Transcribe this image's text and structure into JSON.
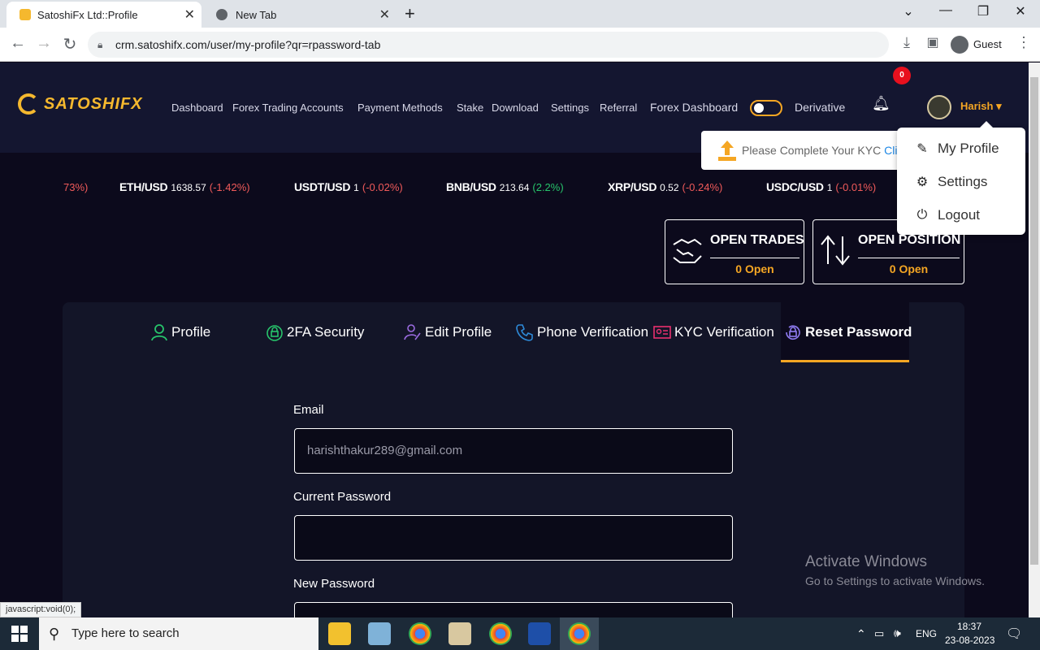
{
  "browser": {
    "tabs": [
      {
        "title": "SatoshiFx Ltd::Profile"
      },
      {
        "title": "New Tab"
      }
    ],
    "url": "crm.satoshifx.com/user/my-profile?qr=rpassword-tab",
    "profile": "Guest",
    "status_bar": "javascript:void(0);"
  },
  "nav": {
    "logo": "SATOSHIFX",
    "links": [
      "Dashboard",
      "Forex Trading Accounts",
      "Payment Methods",
      "Stake",
      "Download",
      "Settings",
      "Referral"
    ],
    "forex_dashboard": "Forex Dashboard",
    "derivative": "Derivative",
    "notifications": "0",
    "user": "Harish",
    "toggle_on": false
  },
  "kyc_banner": {
    "text": "Please Complete Your KYC",
    "link": "Cli"
  },
  "user_menu": [
    "My Profile",
    "Settings",
    "Logout"
  ],
  "ticker": [
    {
      "pair": "",
      "price": "",
      "change": "73%)",
      "dir": "down"
    },
    {
      "pair": "ETH/USD",
      "price": "1638.57",
      "change": "(-1.42%)",
      "dir": "down"
    },
    {
      "pair": "USDT/USD",
      "price": "1",
      "change": "(-0.02%)",
      "dir": "down"
    },
    {
      "pair": "BNB/USD",
      "price": "213.64",
      "change": "(2.2%)",
      "dir": "up"
    },
    {
      "pair": "XRP/USD",
      "price": "0.52",
      "change": "(-0.24%)",
      "dir": "down"
    },
    {
      "pair": "USDC/USD",
      "price": "1",
      "change": "(-0.01%)",
      "dir": "down"
    }
  ],
  "cards": [
    {
      "title": "OPEN TRADES",
      "value": "0 Open"
    },
    {
      "title": "OPEN POSITION",
      "value": "0 Open"
    }
  ],
  "profile_tabs": [
    "Profile",
    "2FA Security",
    "Edit Profile",
    "Phone Verification",
    "KYC Verification",
    "Reset Password"
  ],
  "active_tab": "Reset Password",
  "form": {
    "email_label": "Email",
    "email_value": "harishthakur289@gmail.com",
    "current_password_label": "Current Password",
    "new_password_label": "New Password"
  },
  "watermark": {
    "line1": "Activate Windows",
    "line2": "Go to Settings to activate Windows."
  },
  "taskbar": {
    "search_placeholder": "Type here to search",
    "lang": "ENG",
    "time": "18:37",
    "date": "23-08-2023"
  },
  "colors": {
    "accent": "#f5a623",
    "negative": "#f05a5a",
    "positive": "#27c46b",
    "page_bg": "#0c0a1c"
  }
}
